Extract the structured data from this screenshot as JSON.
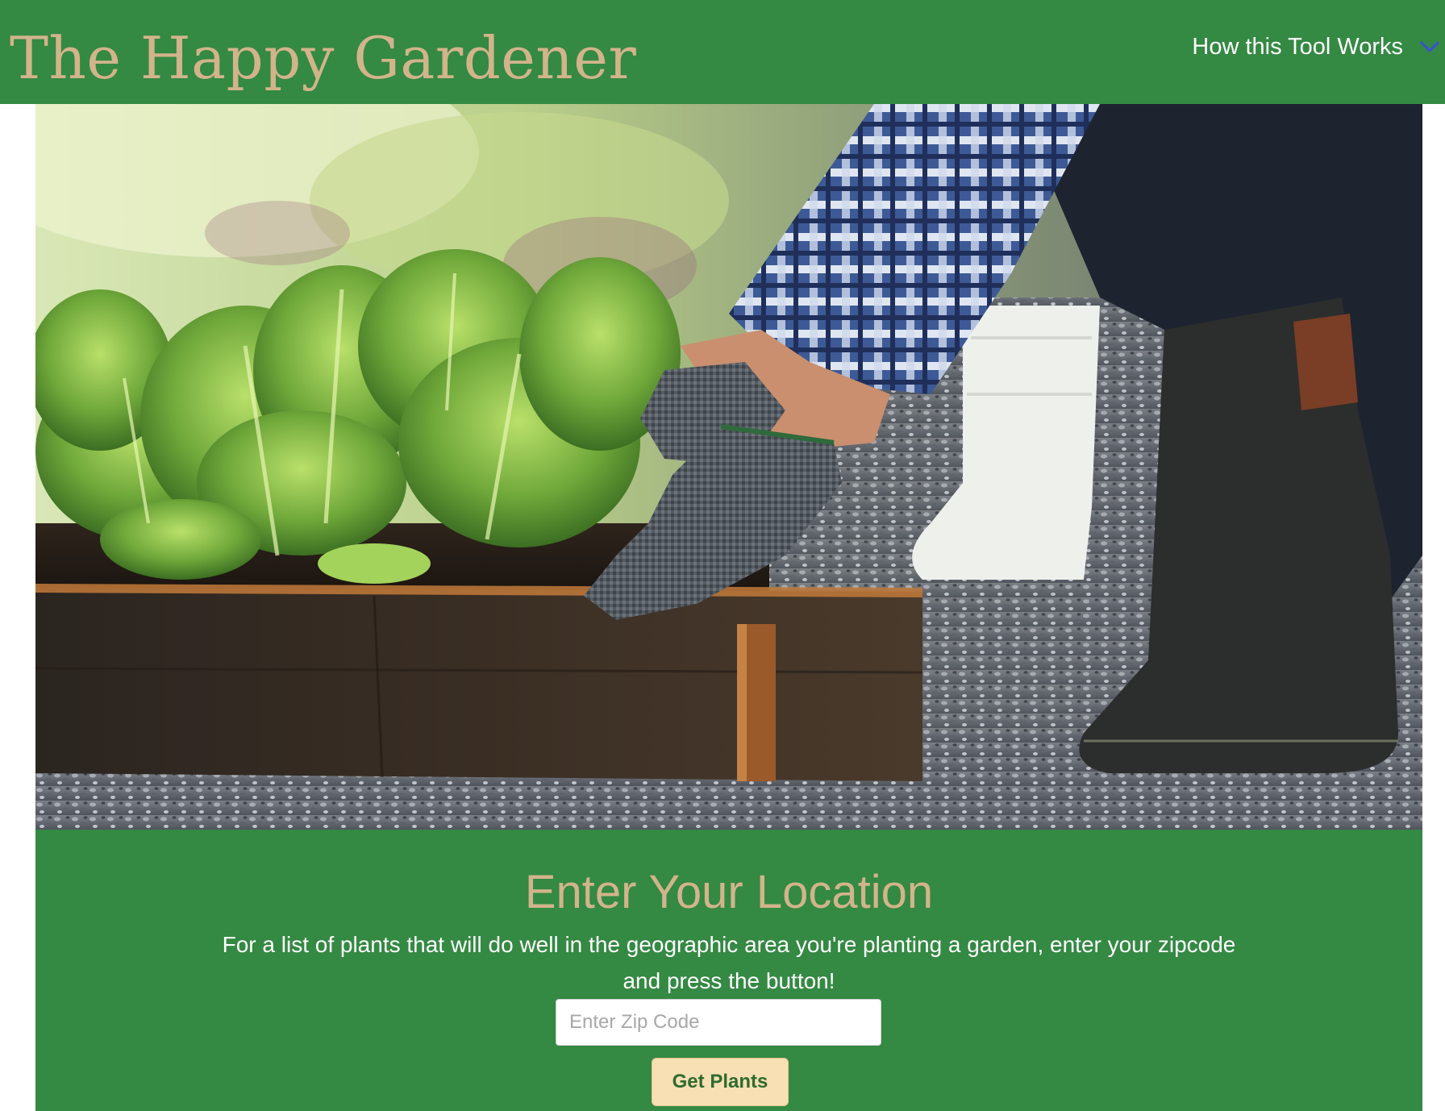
{
  "header": {
    "title": "The Happy Gardener",
    "nav_label": "How this Tool Works",
    "nav_icon": "chevron-down-icon"
  },
  "hero": {
    "image_subject": "gloved hands tending lettuce in a raised wooden garden bed beside rubber boots on gravel"
  },
  "location_panel": {
    "heading": "Enter Your Location",
    "description": "For a list of plants that will do well in the geographic area you're planting a garden, enter your zipcode and press the button!",
    "zip_placeholder": "Enter Zip Code",
    "zip_value": "",
    "button_label": "Get Plants"
  },
  "colors": {
    "header_bg": "#348943",
    "title_text": "#d2b48c",
    "panel_bg": "#348943",
    "button_bg": "#f8dfb4",
    "chevron": "#3b4fd6"
  }
}
